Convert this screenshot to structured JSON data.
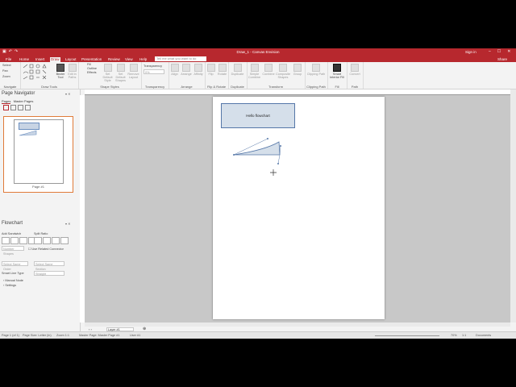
{
  "window": {
    "title": "Draw_1 - Canvas Envision",
    "signin": "Sign in",
    "controls": [
      "–",
      "☐",
      "✕"
    ]
  },
  "menu": {
    "tabs": [
      "File",
      "Home",
      "Insert",
      "Draw",
      "Layout",
      "Presentation",
      "Review",
      "View",
      "Help"
    ],
    "active_tab": "Draw",
    "tellme_placeholder": "Tell me what you want to do",
    "share": "Share"
  },
  "ribbon": {
    "navigate": {
      "label": "Navigate",
      "items": [
        "Select",
        "Pan",
        "Zoom"
      ]
    },
    "draw_tools": {
      "label": "Draw Tools",
      "items": [
        "Bezier Tool",
        "Edit in Paths"
      ]
    },
    "shape_styles": {
      "label": "Shape Styles",
      "items": [
        "Fill",
        "Outline",
        "Effects",
        "Set Default Style",
        "Set Default Shapes",
        "Remove Layout"
      ]
    },
    "transparency": {
      "label": "Transparency",
      "items": [
        "Transparency",
        "0%"
      ]
    },
    "arrange": {
      "label": "Arrange",
      "items": [
        "Align",
        "Arrange",
        "Affinity"
      ]
    },
    "flip_rotate": {
      "label": "Flip & Rotate",
      "items": [
        "Flip",
        "Rotate"
      ]
    },
    "duplicate": {
      "label": "Duplicate",
      "items": [
        "Duplicate"
      ]
    },
    "transform": {
      "label": "Transform",
      "items": [
        "Simple Combine",
        "Combine",
        "Composite Shapes",
        "Group"
      ]
    },
    "clipping": {
      "label": "Clipping Path",
      "items": [
        "Clipping Path"
      ]
    },
    "fill_smart": {
      "label": "Fill",
      "items": [
        "Smart Interior Fill"
      ]
    },
    "path": {
      "label": "Path",
      "items": [
        "Convert"
      ]
    }
  },
  "page_navigator": {
    "title": "Page Navigator",
    "tabs": [
      "Pages",
      "Master Pages"
    ],
    "page_label": "Page #1"
  },
  "flowchart_panel": {
    "title": "Flowchart",
    "add_sandwich": "Add Sandwich",
    "split_ratio": "Split Ratio",
    "number_shapes": "Number Shapes",
    "use_related": "Use Related Connector",
    "select_same_order": "Select Same Order",
    "select_same_section": "Select Same Section",
    "smart_line_type": "Smart Line Type",
    "smart_line_value": "Straight",
    "tree_items": [
      "Manual Node",
      "Settings"
    ]
  },
  "canvas": {
    "flowchart_box_text": "Hello flowchart",
    "layer": "Layer #1"
  },
  "status": {
    "page": "Page 1 (of 1)",
    "page_size": "Page Size: Letter (in)",
    "zoom_level": "Zoom 1:1",
    "master_page": "Master Page: Master Page #1",
    "user": "User #1",
    "zoom_pct": "70%",
    "ratio": "1:1",
    "doc": "Documents"
  }
}
